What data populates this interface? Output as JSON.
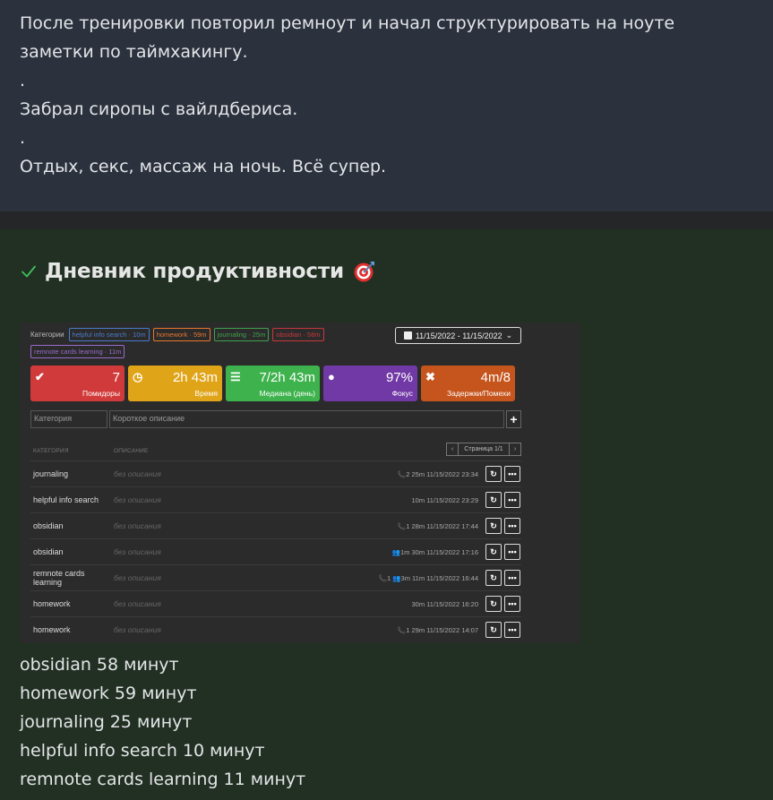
{
  "note": {
    "lines": [
      "После тренировки повторил ремноут и начал структурировать на ноуте заметки по таймхакингу.",
      ".",
      "Забрал сиропы с вайлдбериса.",
      ".",
      "Отдых, секс, массаж на ночь. Всё супер."
    ]
  },
  "diary": {
    "title": "Дневник продуктивности",
    "check_icon": "check-icon",
    "title_icon": "target-icon"
  },
  "screenshot": {
    "categories_label": "Категории",
    "chips": [
      "helpful info search · 10m",
      "homework · 59m",
      "journaling · 25m",
      "obsidian · 58m",
      "remnote cards learning · 11m"
    ],
    "date_range": "11/15/2022 - 11/15/2022",
    "stats": [
      {
        "value": "7",
        "label": "Помидоры",
        "icon": "check-circle-icon",
        "color": "#d13a3a"
      },
      {
        "value": "2h 43m",
        "label": "Время",
        "icon": "clock-icon",
        "color": "#e0a419"
      },
      {
        "value": "7/2h 43m",
        "label": "Медиана (день)",
        "icon": "list-icon",
        "color": "#3eb24c"
      },
      {
        "value": "97%",
        "label": "Фокус",
        "icon": "bulb-icon",
        "color": "#7139a5"
      },
      {
        "value": "4m/8",
        "label": "Задержки/Помехи",
        "icon": "x-icon",
        "color": "#c5541d"
      }
    ],
    "input_category_placeholder": "Категория",
    "input_desc_placeholder": "Короткое описание",
    "col_category": "КАТЕГОРИЯ",
    "col_description": "ОПИСАНИЕ",
    "pager_text": "Страница 1/1",
    "rows": [
      {
        "category": "journaling",
        "description": "без описания",
        "meta": "📞2  25m 11/15/2022 23:34"
      },
      {
        "category": "helpful info search",
        "description": "без описания",
        "meta": "10m 11/15/2022 23:29"
      },
      {
        "category": "obsidian",
        "description": "без описания",
        "meta": "📞1  28m 11/15/2022 17:44"
      },
      {
        "category": "obsidian",
        "description": "без описания",
        "meta": "👥1m  30m 11/15/2022 17:16"
      },
      {
        "category": "remnote cards learning",
        "description": "без описания",
        "meta": "📞1  👥3m  11m 11/15/2022 16:44"
      },
      {
        "category": "homework",
        "description": "без описания",
        "meta": "30m 11/15/2022 16:20"
      },
      {
        "category": "homework",
        "description": "без описания",
        "meta": "📞1  29m 11/15/2022 14:07"
      }
    ]
  },
  "summary": {
    "lines": [
      "obsidian 58 минут",
      "homework 59 минут",
      "journaling 25 минут",
      "helpful info search 10 минут",
      "remnote cards learning 11 минут"
    ]
  }
}
